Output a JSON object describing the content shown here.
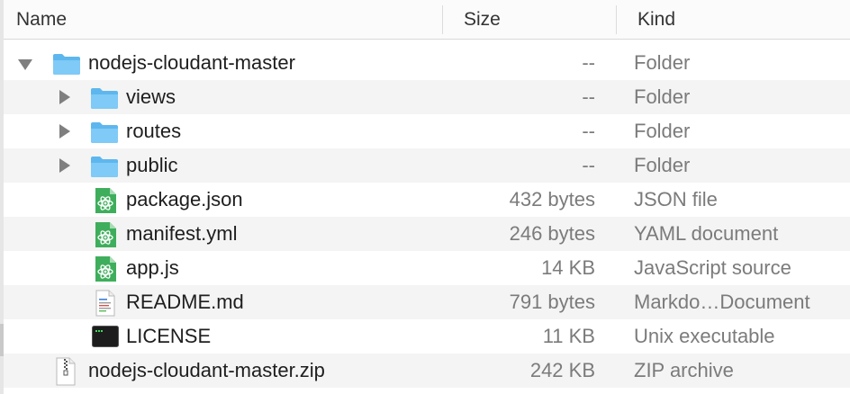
{
  "columns": {
    "name": "Name",
    "size": "Size",
    "kind": "Kind"
  },
  "colors": {
    "folder": "#6cc3f3",
    "atom_bg": "#3fae5c",
    "text": "#1e1e1e",
    "muted": "#7b7b7b"
  },
  "rows": [
    {
      "name": "nodejs-cloudant-master",
      "size": "--",
      "kind": "Folder",
      "icon": "folder-icon",
      "disclosure": "expanded"
    },
    {
      "name": "views",
      "size": "--",
      "kind": "Folder",
      "icon": "folder-icon",
      "disclosure": "collapsed"
    },
    {
      "name": "routes",
      "size": "--",
      "kind": "Folder",
      "icon": "folder-icon",
      "disclosure": "collapsed"
    },
    {
      "name": "public",
      "size": "--",
      "kind": "Folder",
      "icon": "folder-icon",
      "disclosure": "collapsed"
    },
    {
      "name": "package.json",
      "size": "432 bytes",
      "kind": "JSON file",
      "icon": "atom-file-icon"
    },
    {
      "name": "manifest.yml",
      "size": "246 bytes",
      "kind": "YAML document",
      "icon": "atom-file-icon"
    },
    {
      "name": "app.js",
      "size": "14 KB",
      "kind": "JavaScript source",
      "icon": "atom-file-icon"
    },
    {
      "name": "README.md",
      "size": "791 bytes",
      "kind": "Markdo…Document",
      "icon": "markdown-file-icon"
    },
    {
      "name": "LICENSE",
      "size": "11 KB",
      "kind": "Unix executable",
      "icon": "terminal-icon"
    },
    {
      "name": "nodejs-cloudant-master.zip",
      "size": "242 KB",
      "kind": "ZIP archive",
      "icon": "zip-file-icon"
    }
  ]
}
